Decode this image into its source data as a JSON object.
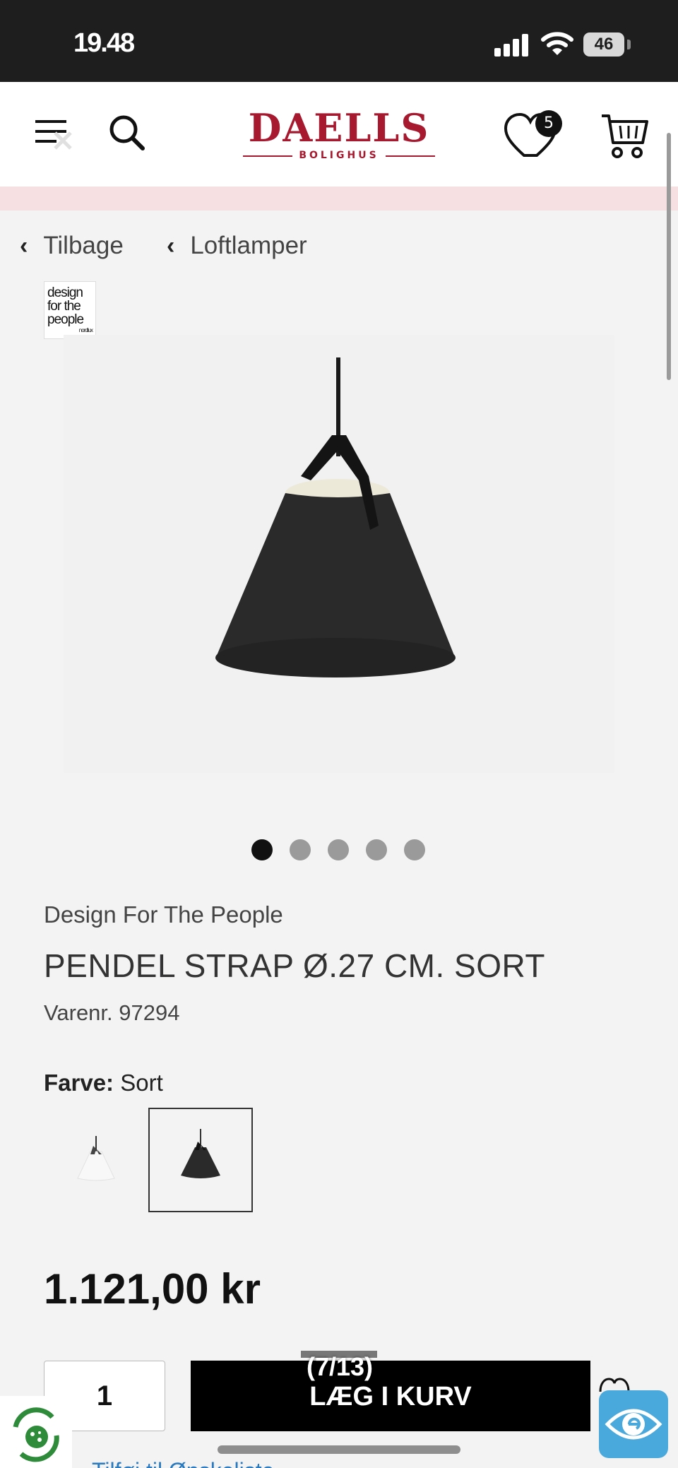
{
  "status_bar": {
    "time": "19.48",
    "battery": "46"
  },
  "header": {
    "logo": {
      "brand": "DAELLS",
      "sub": "BOLIGHUS"
    },
    "wishlist_count": "5"
  },
  "breadcrumb": {
    "back_label": "Tilbage",
    "category_label": "Loftlamper"
  },
  "brand_badge": {
    "line1": "design",
    "line2": "for the",
    "line3": "people",
    "maker": "nordlux"
  },
  "product": {
    "brand": "Design For The People",
    "title": "PENDEL STRAP Ø.27 CM. SORT",
    "sku_label": "Varenr. 97294",
    "color_label": "Farve:",
    "color_value": "Sort",
    "price": "1.121,00 kr",
    "quantity": "1",
    "add_to_cart_label": "LÆG I KURV",
    "swatches": [
      {
        "name": "Hvid",
        "selected": false
      },
      {
        "name": "Sort",
        "selected": true
      }
    ]
  },
  "gallery": {
    "counter": "(7/13)",
    "dots": 5,
    "active_dot": 1
  },
  "partial_link": "Tilføj til Ønskeliste",
  "icons": {
    "menu": "menu-close-icon",
    "search": "search-icon",
    "wishlist": "heart-icon",
    "cart": "cart-icon",
    "accessibility": "eye-icon",
    "cookie": "cookie-icon"
  },
  "colors": {
    "brand": "#a6192e",
    "accent_blue": "#4aa9dc",
    "button": "#000000"
  }
}
